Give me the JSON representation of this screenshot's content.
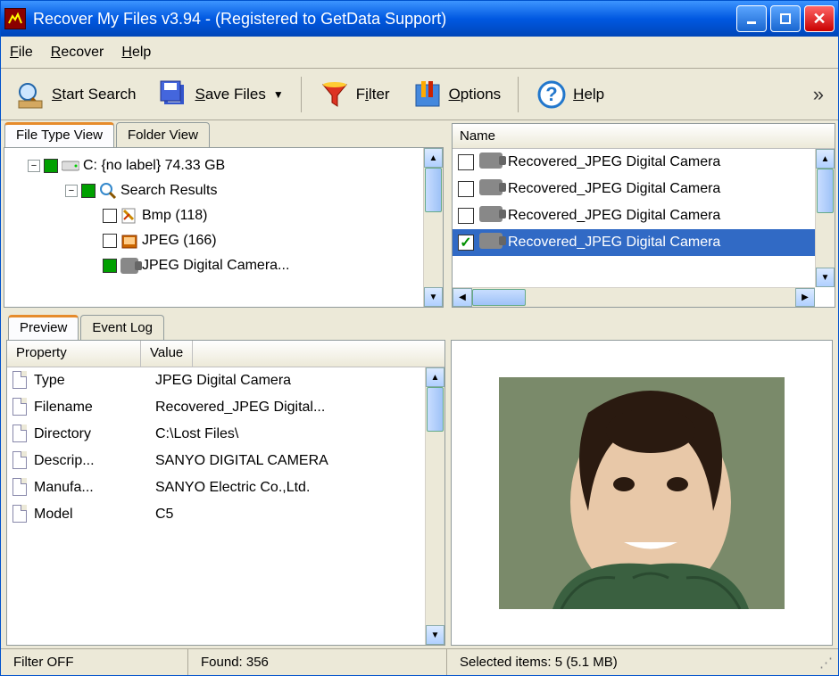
{
  "titlebar": {
    "title": "Recover My Files v3.94   -   (Registered to GetData Support)"
  },
  "menubar": {
    "file": "File",
    "recover": "Recover",
    "help": "Help"
  },
  "toolbar": {
    "start_search": "Start Search",
    "save_files": "Save Files",
    "filter": "Filter",
    "options": "Options",
    "help": "Help"
  },
  "left_tabs": {
    "file_type": "File Type View",
    "folder": "Folder View"
  },
  "tree": {
    "drive": "C: {no label}   74.33 GB",
    "search_results": "Search Results",
    "items": [
      {
        "label": "Bmp (118)",
        "icon": "bmp"
      },
      {
        "label": "JPEG (166)",
        "icon": "jpeg"
      },
      {
        "label": "JPEG Digital Camera...",
        "icon": "camera",
        "green": true
      }
    ]
  },
  "right_header": "Name",
  "files": [
    {
      "name": "Recovered_JPEG Digital Camera",
      "checked": false,
      "selected": false
    },
    {
      "name": "Recovered_JPEG Digital Camera",
      "checked": false,
      "selected": false
    },
    {
      "name": "Recovered_JPEG Digital Camera",
      "checked": false,
      "selected": false
    },
    {
      "name": "Recovered_JPEG Digital Camera",
      "checked": true,
      "selected": true
    }
  ],
  "bottom_tabs": {
    "preview": "Preview",
    "event_log": "Event Log"
  },
  "prop_headers": {
    "property": "Property",
    "value": "Value"
  },
  "properties": [
    {
      "name": "Type",
      "value": "JPEG Digital Camera"
    },
    {
      "name": "Filename",
      "value": "Recovered_JPEG Digital..."
    },
    {
      "name": "Directory",
      "value": "C:\\Lost Files\\"
    },
    {
      "name": "Descrip...",
      "value": "SANYO DIGITAL CAMERA"
    },
    {
      "name": "Manufa...",
      "value": "SANYO Electric Co.,Ltd."
    },
    {
      "name": "Model",
      "value": "C5"
    }
  ],
  "statusbar": {
    "filter": "Filter OFF",
    "found": "Found: 356",
    "selected": "Selected items: 5 (5.1 MB)"
  }
}
